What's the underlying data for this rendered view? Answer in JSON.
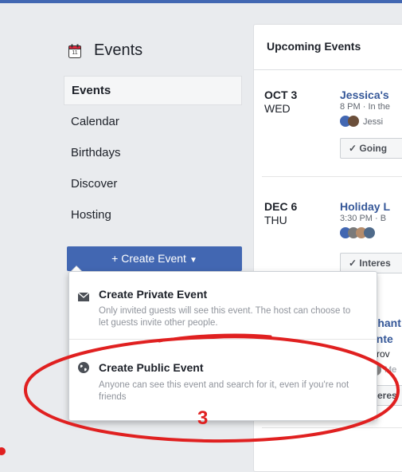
{
  "sidebar": {
    "icon": "calendar-icon",
    "calendar_day": "11",
    "title": "Events",
    "items": [
      {
        "label": "Events",
        "active": true
      },
      {
        "label": "Calendar"
      },
      {
        "label": "Birthdays"
      },
      {
        "label": "Discover"
      },
      {
        "label": "Hosting"
      }
    ],
    "create_button": "+ Create Event"
  },
  "dropdown": {
    "private": {
      "icon": "envelope-icon",
      "label": "Create Private Event",
      "description": "Only invited guests will see this event. The host can choose to let guests invite other people."
    },
    "public": {
      "icon": "globe-icon",
      "label": "Create Public Event",
      "description": "Anyone can see this event and search for it, even if you're not friends"
    }
  },
  "upcoming": {
    "title": "Upcoming Events",
    "events": [
      {
        "date": "OCT 3",
        "day": "WED",
        "title": "Jessica's",
        "meta": "8 PM · In the",
        "guests": "Jessi",
        "button": "Going"
      },
      {
        "date": "DEC 6",
        "day": "THU",
        "title": "Holiday L",
        "meta": "3:30 PM · B",
        "button": "Interes"
      }
    ],
    "partial_event": {
      "title_line1": "Phant",
      "title_line2": "ente",
      "meta1": "Prov",
      "meta2": "Me",
      "button": "teres"
    }
  },
  "annotation": {
    "number": "3",
    "color": "#e02020"
  },
  "colors": {
    "accent": "#4267b2",
    "link": "#365899",
    "page_bg": "#e9ebee"
  }
}
